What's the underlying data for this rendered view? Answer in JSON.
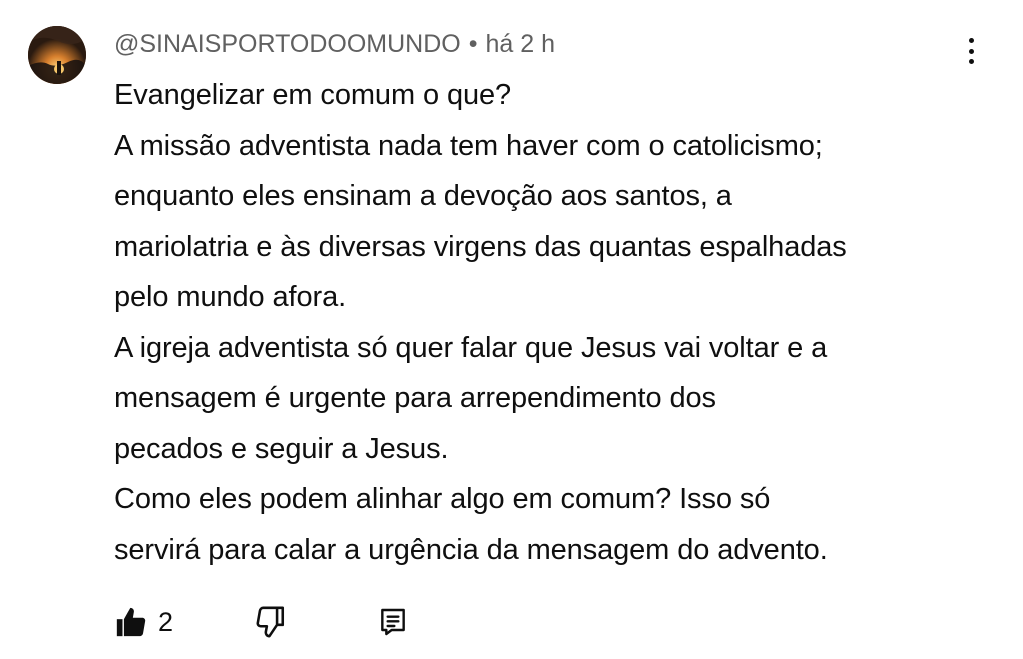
{
  "comment": {
    "author": "@SINAISPORTODOOMUNDO",
    "separator": "•",
    "time": "há 2 h",
    "lines": [
      "Evangelizar em comum o que?",
      "A missão adventista nada tem haver com o catolicismo;",
      "enquanto eles ensinam a devoção aos santos, a",
      "mariolatria e às diversas virgens das quantas espalhadas",
      "pelo mundo afora.",
      "A igreja adventista só quer falar que Jesus vai voltar e a",
      "mensagem é urgente para arrependimento dos",
      "pecados e seguir a Jesus.",
      "Como eles podem alinhar algo em comum? Isso só",
      "servirá para calar a urgência da mensagem do advento."
    ],
    "like_count": "2"
  },
  "icons": {
    "more": "more-vert-icon",
    "like": "thumb-up-filled-icon",
    "dislike": "thumb-down-outline-icon",
    "reply": "comment-reply-icon"
  },
  "colors": {
    "text": "#0f0f0f",
    "meta": "#606060",
    "background": "#ffffff"
  }
}
